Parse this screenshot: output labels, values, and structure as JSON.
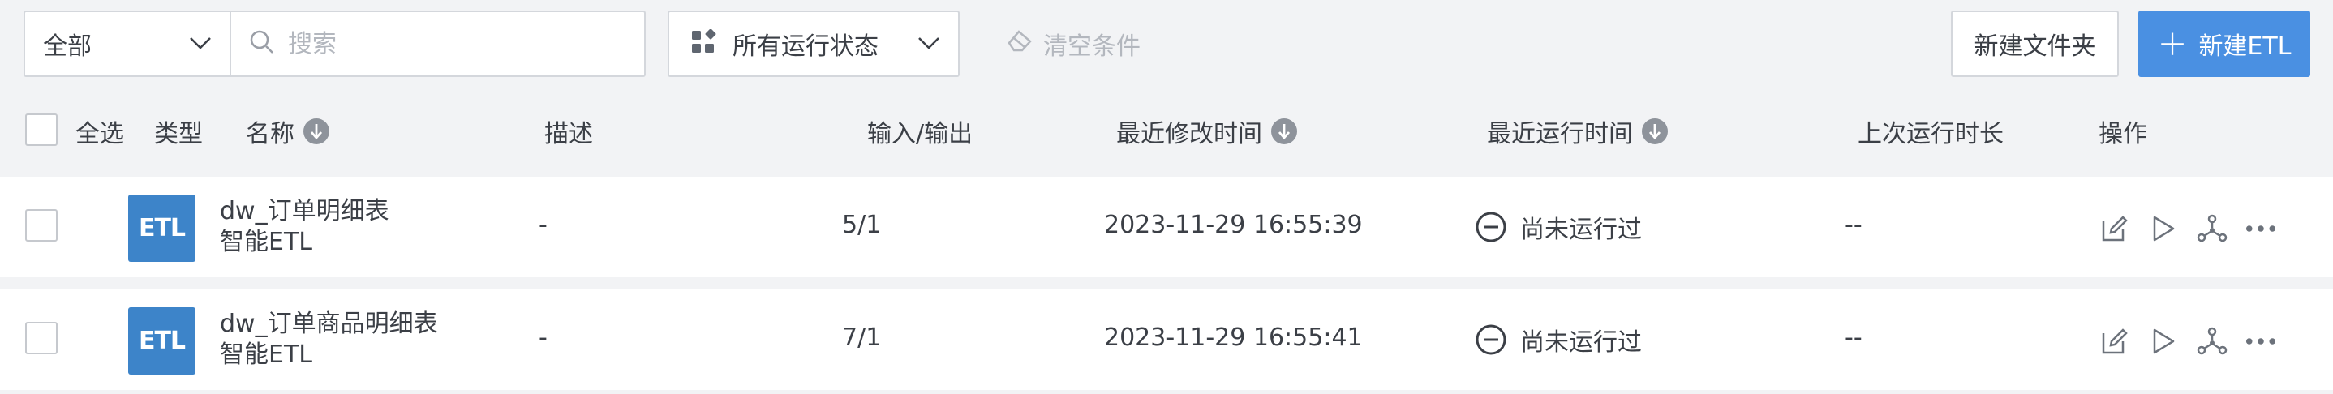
{
  "toolbar": {
    "scope_select": "全部",
    "search_placeholder": "搜索",
    "status_filter": "所有运行状态",
    "clear_label": "清空条件",
    "new_folder_label": "新建文件夹",
    "new_etl_label": "新建ETL"
  },
  "table": {
    "select_all": "全选",
    "columns": {
      "type": "类型",
      "name": "名称",
      "desc": "描述",
      "io": "输入/输出",
      "modified": "最近修改时间",
      "last_run": "最近运行时间",
      "duration": "上次运行时长",
      "ops": "操作"
    },
    "rows": [
      {
        "badge": "ETL",
        "name": "dw_订单明细表",
        "subtype": "智能ETL",
        "desc": "-",
        "io": "5/1",
        "modified": "2023-11-29 16:55:39",
        "run_status": "尚未运行过",
        "duration": "--"
      },
      {
        "badge": "ETL",
        "name": "dw_订单商品明细表",
        "subtype": "智能ETL",
        "desc": "-",
        "io": "7/1",
        "modified": "2023-11-29 16:55:41",
        "run_status": "尚未运行过",
        "duration": "--"
      }
    ]
  },
  "colors": {
    "primary": "#4a90e2",
    "badge": "#3d84c9",
    "background": "#f2f3f5"
  },
  "icons": [
    "chevron-down-icon",
    "search-icon",
    "grid-icon",
    "eraser-icon",
    "plus-icon",
    "sort-icon",
    "not-run-icon",
    "edit-icon",
    "play-icon",
    "lineage-icon",
    "more-icon"
  ]
}
